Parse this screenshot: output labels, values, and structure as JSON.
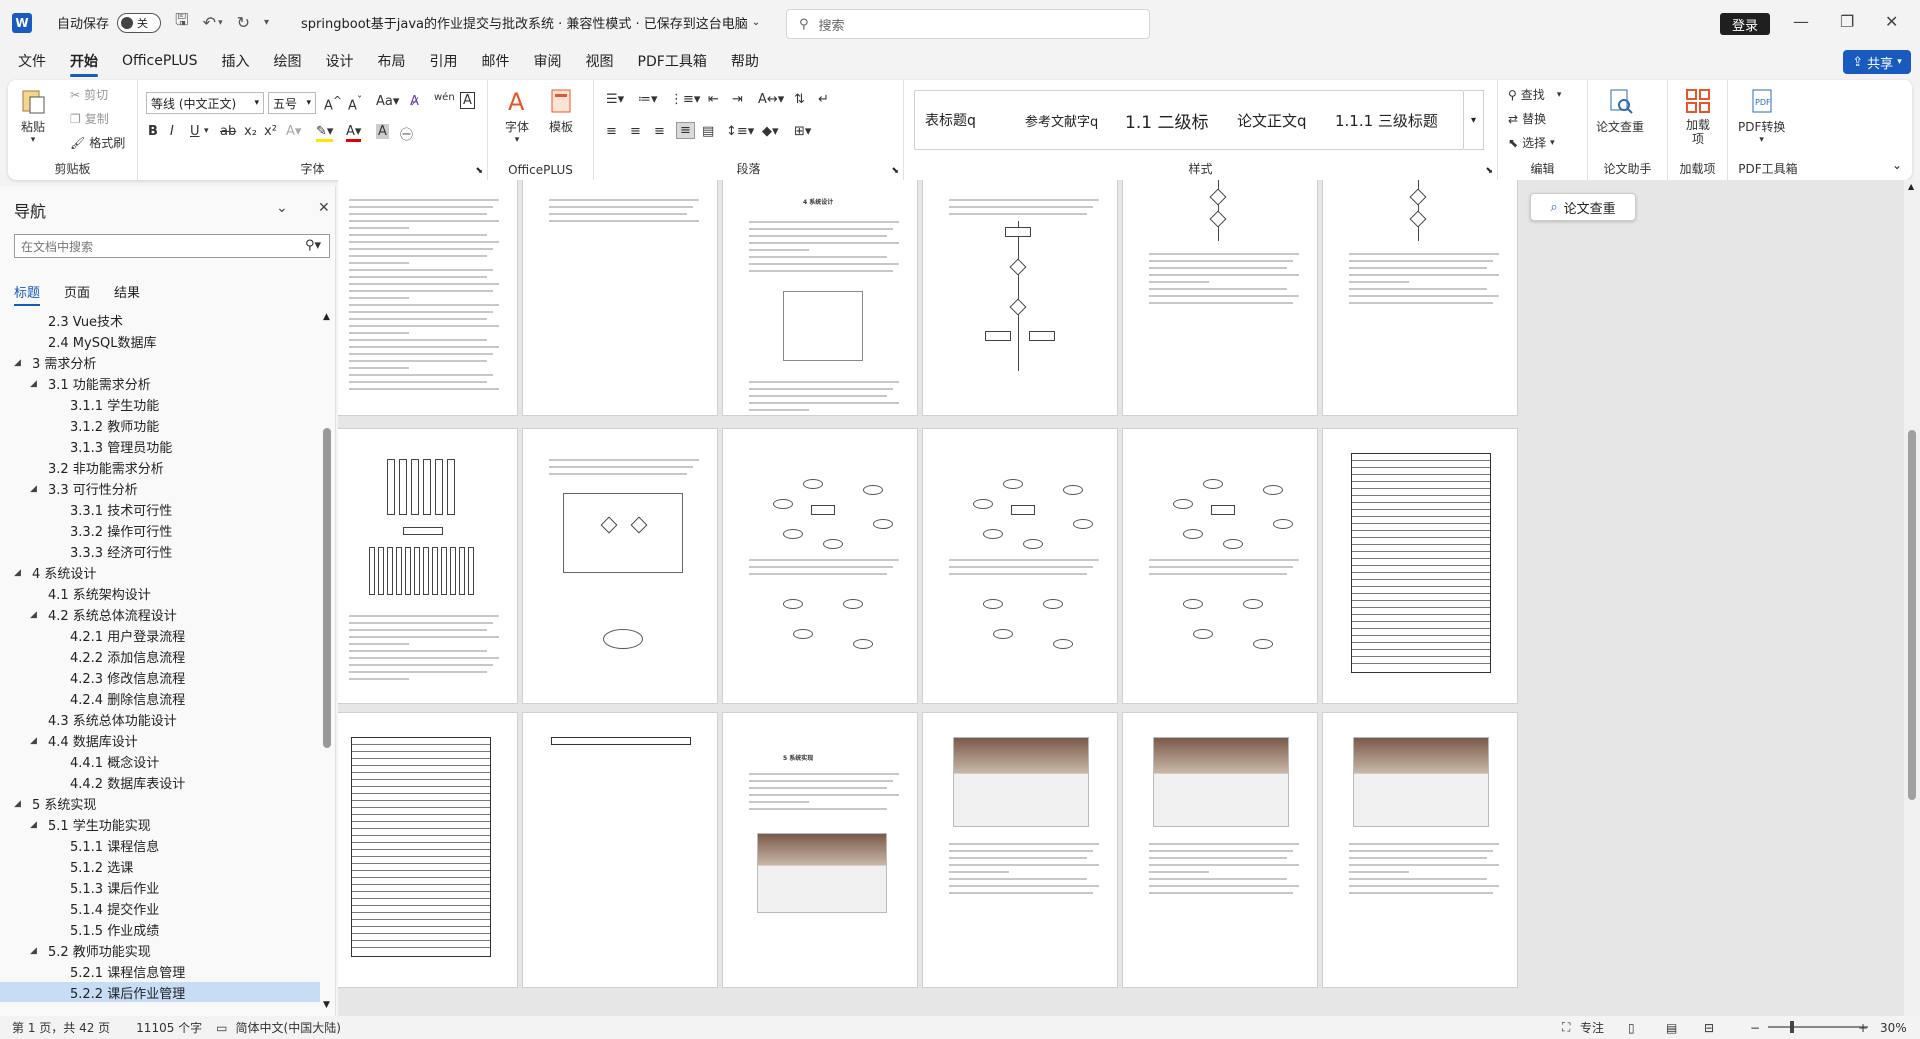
{
  "titlebar": {
    "app_logo": "W",
    "autosave_label": "自动保存",
    "autosave_state": "关",
    "doc_title": "springboot基于java的作业提交与批改系统 · 兼容性模式 · 已保存到这台电脑",
    "search_placeholder": "搜索",
    "login_label": "登录"
  },
  "menu": {
    "tabs": [
      "文件",
      "开始",
      "OfficePLUS",
      "插入",
      "绘图",
      "设计",
      "布局",
      "引用",
      "邮件",
      "审阅",
      "视图",
      "PDF工具箱",
      "帮助"
    ],
    "active": "开始",
    "share_label": "共享"
  },
  "ribbon": {
    "clipboard": {
      "label": "剪贴板",
      "paste": "粘贴",
      "cut": "剪切",
      "copy": "复制",
      "format_painter": "格式刷"
    },
    "font": {
      "label": "字体",
      "font_name": "等线 (中文正文)",
      "font_size": "五号"
    },
    "officeplus": {
      "label": "OfficePLUS",
      "font_btn": "字体",
      "template_btn": "模板"
    },
    "paragraph": {
      "label": "段落"
    },
    "styles": {
      "label": "样式",
      "items": [
        "表标题q",
        "参考文献字q",
        "1.1  二级标",
        "论文正文q",
        "1.1.1  三级标题"
      ]
    },
    "editing": {
      "label": "编辑",
      "find": "查找",
      "replace": "替换",
      "select": "选择"
    },
    "thesis": {
      "label": "论文助手",
      "btn": "论文查重"
    },
    "addins": {
      "label": "加载项",
      "btn": "加载项"
    },
    "pdf": {
      "label": "PDF工具箱",
      "btn": "PDF转换"
    }
  },
  "nav": {
    "title": "导航",
    "search_placeholder": "在文档中搜索",
    "tabs": [
      "标题",
      "页面",
      "结果"
    ],
    "active_tab": "标题",
    "tree": [
      {
        "text": "2.3 Vue技术",
        "level": 2,
        "caret": ""
      },
      {
        "text": "2.4 MySQL数据库",
        "level": 2,
        "caret": ""
      },
      {
        "text": "3 需求分析",
        "level": 1,
        "caret": "◢"
      },
      {
        "text": "3.1 功能需求分析",
        "level": 2,
        "caret": "◢"
      },
      {
        "text": "3.1.1 学生功能",
        "level": 3,
        "caret": ""
      },
      {
        "text": "3.1.2 教师功能",
        "level": 3,
        "caret": ""
      },
      {
        "text": "3.1.3 管理员功能",
        "level": 3,
        "caret": ""
      },
      {
        "text": "3.2 非功能需求分析",
        "level": 2,
        "caret": ""
      },
      {
        "text": "3.3 可行性分析",
        "level": 2,
        "caret": "◢"
      },
      {
        "text": "3.3.1 技术可行性",
        "level": 3,
        "caret": ""
      },
      {
        "text": "3.3.2 操作可行性",
        "level": 3,
        "caret": ""
      },
      {
        "text": "3.3.3 经济可行性",
        "level": 3,
        "caret": ""
      },
      {
        "text": "4 系统设计",
        "level": 1,
        "caret": "◢"
      },
      {
        "text": "4.1 系统架构设计",
        "level": 2,
        "caret": ""
      },
      {
        "text": "4.2 系统总体流程设计",
        "level": 2,
        "caret": "◢"
      },
      {
        "text": "4.2.1 用户登录流程",
        "level": 3,
        "caret": ""
      },
      {
        "text": "4.2.2 添加信息流程",
        "level": 3,
        "caret": ""
      },
      {
        "text": "4.2.3 修改信息流程",
        "level": 3,
        "caret": ""
      },
      {
        "text": "4.2.4 删除信息流程",
        "level": 3,
        "caret": ""
      },
      {
        "text": "4.3 系统总体功能设计",
        "level": 2,
        "caret": ""
      },
      {
        "text": "4.4 数据库设计",
        "level": 2,
        "caret": "◢"
      },
      {
        "text": "4.4.1 概念设计",
        "level": 3,
        "caret": ""
      },
      {
        "text": "4.4.2 数据库表设计",
        "level": 3,
        "caret": ""
      },
      {
        "text": "5 系统实现",
        "level": 1,
        "caret": "◢"
      },
      {
        "text": "5.1 学生功能实现",
        "level": 2,
        "caret": "◢"
      },
      {
        "text": "5.1.1 课程信息",
        "level": 3,
        "caret": ""
      },
      {
        "text": "5.1.2 选课",
        "level": 3,
        "caret": ""
      },
      {
        "text": "5.1.3 课后作业",
        "level": 3,
        "caret": ""
      },
      {
        "text": "5.1.4 提交作业",
        "level": 3,
        "caret": ""
      },
      {
        "text": "5.1.5 作业成绩",
        "level": 3,
        "caret": ""
      },
      {
        "text": "5.2 教师功能实现",
        "level": 2,
        "caret": "◢"
      },
      {
        "text": "5.2.1 课程信息管理",
        "level": 3,
        "caret": ""
      },
      {
        "text": "5.2.2 课后作业管理",
        "level": 3,
        "caret": "",
        "selected": true
      }
    ]
  },
  "doc": {
    "thesis_check_label": "论文查重",
    "page_headings": {
      "p3": "4   系统设计",
      "p15": "5   系统实现"
    }
  },
  "status": {
    "page": "第 1 页，共 42 页",
    "words": "11105 个字",
    "lang": "简体中文(中国大陆)",
    "focus": "专注",
    "zoom": "30%"
  },
  "colors": {
    "accent": "#185abd",
    "selected": "#c7dcf5"
  }
}
